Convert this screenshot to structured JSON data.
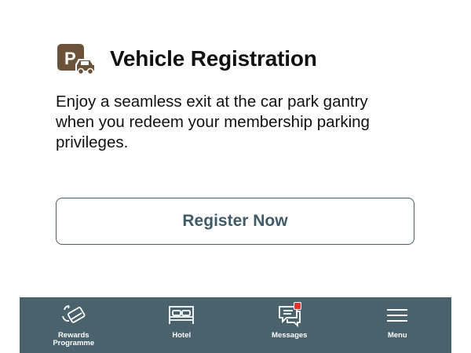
{
  "section": {
    "title": "Vehicle Registration",
    "icon_letter": "P",
    "description": "Enjoy a seamless exit at the car park gantry when you redeem your membership parking privileges."
  },
  "actions": {
    "register_label": "Register Now"
  },
  "bottom_nav": {
    "items": [
      {
        "label": "Rewards Programme",
        "icon": "rewards-card-icon"
      },
      {
        "label": "Hotel",
        "icon": "bed-icon"
      },
      {
        "label": "Messages",
        "icon": "chat-bubbles-icon",
        "has_badge": true
      },
      {
        "label": "Menu",
        "icon": "hamburger-menu-icon"
      }
    ]
  },
  "colors": {
    "nav_background": "#4a626c",
    "button_text": "#3f5b66",
    "icon_brown": "#6b5339",
    "badge": "#e0342d"
  }
}
